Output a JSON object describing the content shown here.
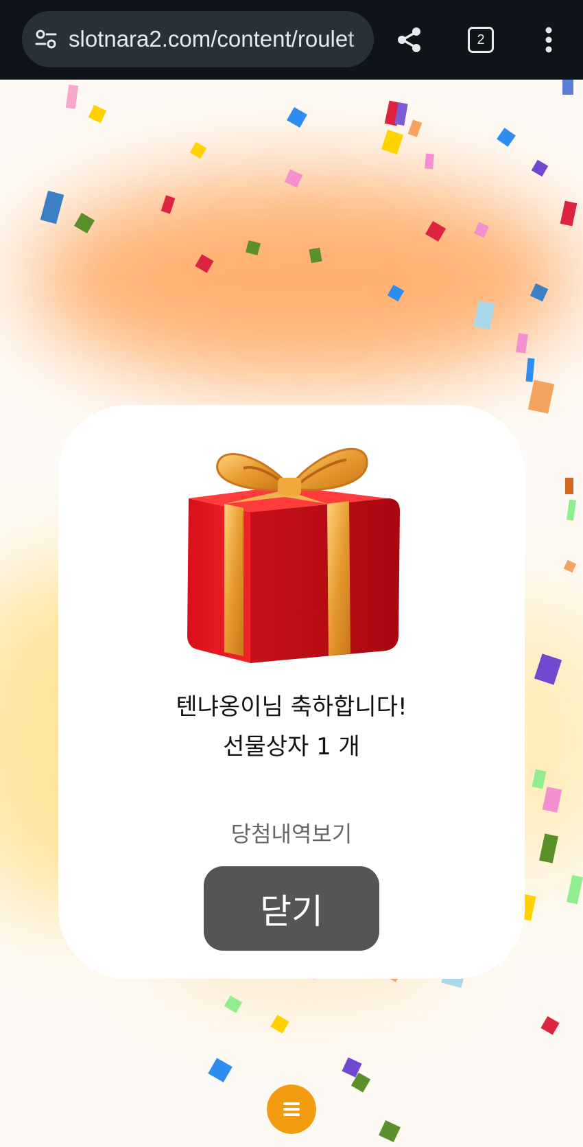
{
  "browser": {
    "url": "slotnara2.com/content/roulet",
    "tab_count": "2",
    "icons": [
      "site-settings-icon",
      "share-icon",
      "tabs-icon",
      "more-vert-icon"
    ]
  },
  "modal": {
    "congrats_text": "텐냐옹이님 축하합니다!",
    "prize_text": "선물상자 1 개",
    "history_link": "당첨내역보기",
    "close_label": "닫기",
    "image": "gift-box-icon"
  },
  "fab": {
    "icon": "menu-icon",
    "color": "#f39c12"
  },
  "colors": {
    "topbar": "#0f141a",
    "urlbar": "#263238",
    "close_button": "#555555"
  }
}
